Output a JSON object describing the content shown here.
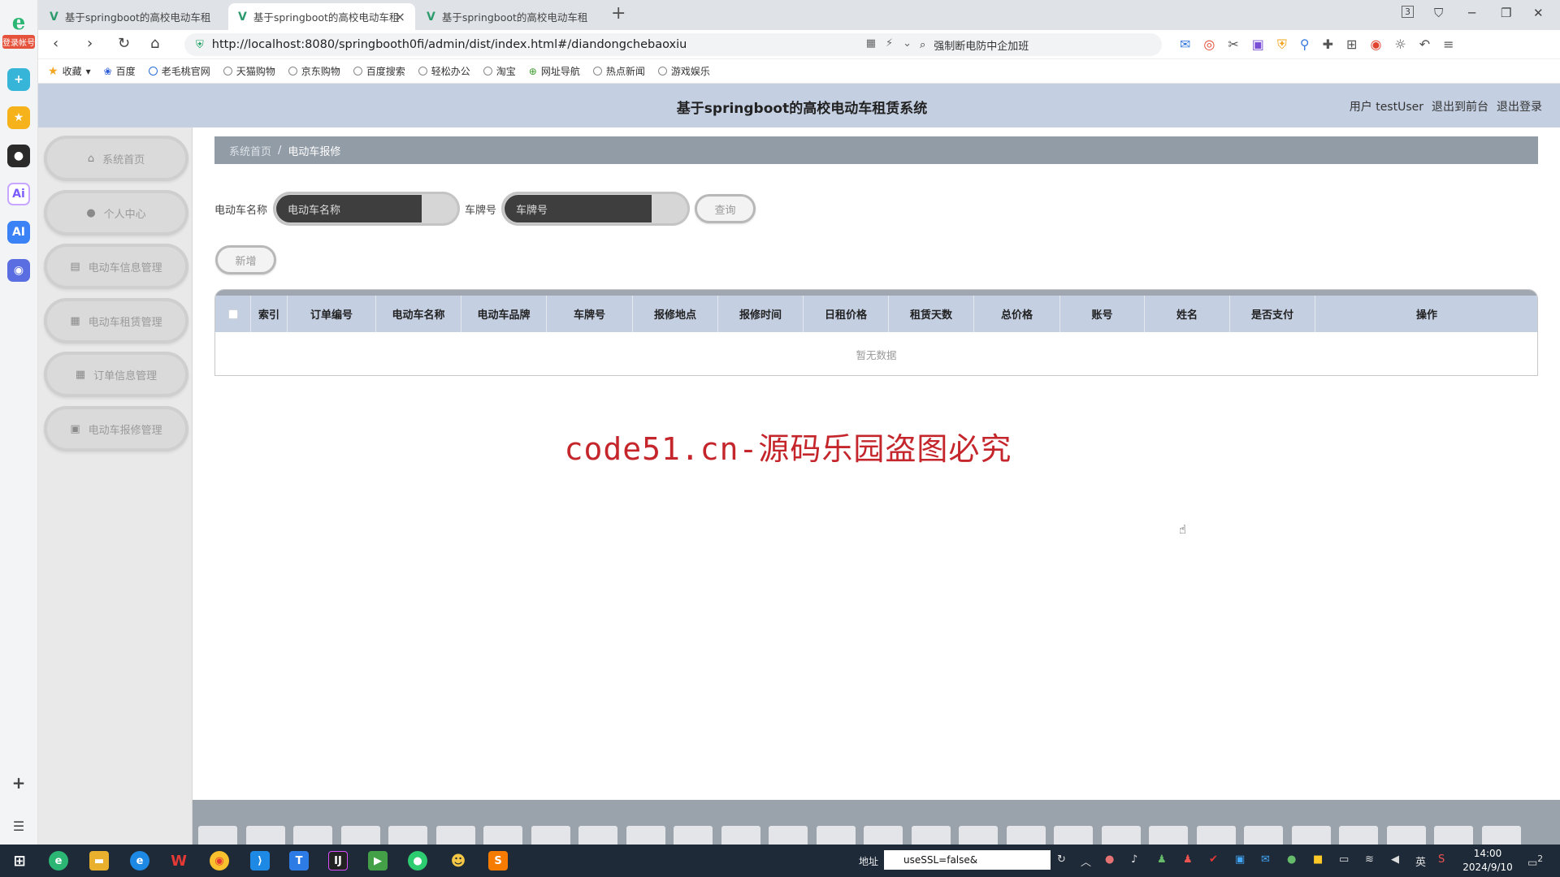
{
  "browser": {
    "rail_badge": "登录帐号",
    "tabs": [
      {
        "title": "基于springboot的高校电动车租",
        "active": false
      },
      {
        "title": "基于springboot的高校电动车租",
        "active": true
      },
      {
        "title": "基于springboot的高校电动车租",
        "active": false
      }
    ],
    "new_tab": "+",
    "address": "http://localhost:8080/springbooth0fi/admin/dist/index.html#/diandongchebaoxiu",
    "search_placeholder": "强制断电防中企加班",
    "tab_count_badge": "3",
    "bookmarks": [
      "收藏",
      "百度",
      "老毛桃官网",
      "天猫购物",
      "京东购物",
      "百度搜索",
      "轻松办公",
      "淘宝",
      "网址导航",
      "热点新闻",
      "游戏娱乐"
    ]
  },
  "app": {
    "title": "基于springboot的高校电动车租赁系统",
    "user_label": "用户 testUser",
    "back_to_front": "退出到前台",
    "logout": "退出登录",
    "menu": [
      {
        "label": "系统首页",
        "icon": "home-icon"
      },
      {
        "label": "个人中心",
        "icon": "user-icon"
      },
      {
        "label": "电动车信息管理",
        "icon": "clipboard-icon"
      },
      {
        "label": "电动车租赁管理",
        "icon": "grid-icon"
      },
      {
        "label": "订单信息管理",
        "icon": "grid-icon"
      },
      {
        "label": "电动车报修管理",
        "icon": "clipboard-check-icon"
      }
    ],
    "breadcrumb": {
      "home": "系统首页",
      "separator": "/",
      "current": "电动车报修"
    },
    "search": {
      "name_label": "电动车名称",
      "name_placeholder": "电动车名称",
      "plate_label": "车牌号",
      "plate_placeholder": "车牌号",
      "query_button": "查询"
    },
    "add_button": "新增",
    "table": {
      "columns": [
        "索引",
        "订单编号",
        "电动车名称",
        "电动车品牌",
        "车牌号",
        "报修地点",
        "报修时间",
        "日租价格",
        "租赁天数",
        "总价格",
        "账号",
        "姓名",
        "是否支付",
        "操作"
      ],
      "empty_text": "暂无数据"
    },
    "watermark": "code51.cn-源码乐园盗图必究"
  },
  "taskbar": {
    "address_label": "地址",
    "address_value": "useSSL=false&",
    "ime": "英",
    "time": "14:00",
    "date": "2024/9/10",
    "notification_count": "2"
  },
  "colors": {
    "header_bg": "#c4cfe2",
    "breadcrumb_bg": "#929ca6",
    "watermark": "#c4262c",
    "taskbar_bg": "#1e2a38"
  }
}
